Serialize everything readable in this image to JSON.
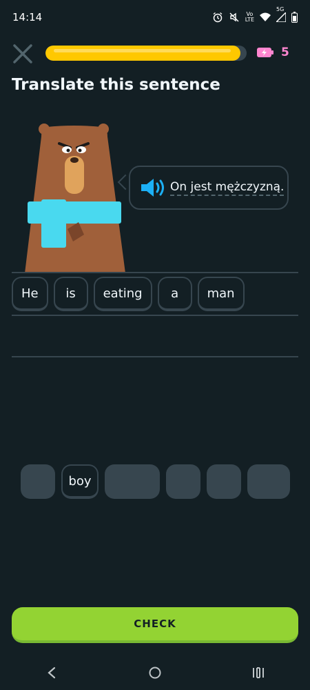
{
  "status_bar": {
    "time": "14:14",
    "icons": [
      "alarm-icon",
      "mute-icon",
      "volte-icon",
      "wifi-icon",
      "signal-5g-icon",
      "battery-icon"
    ],
    "network_label": "5G",
    "volte_label_top": "Vo",
    "volte_label_bottom": "LTE"
  },
  "lesson": {
    "progress_fraction": 0.97,
    "progress_color": "#ffc800",
    "energy_count": "5",
    "energy_color": "#ff86d0"
  },
  "title": "Translate this sentence",
  "prompt": {
    "sentence": "On jest mężczyzną."
  },
  "answer_chips": [
    "He",
    "is",
    "eating",
    "a",
    "man"
  ],
  "word_bank": [
    {
      "label": "",
      "filled": false
    },
    {
      "label": "boy",
      "filled": true
    },
    {
      "label": "",
      "filled": false
    },
    {
      "label": "",
      "filled": false
    },
    {
      "label": "",
      "filled": false
    },
    {
      "label": "",
      "filled": false
    }
  ],
  "check_button": {
    "label": "CHECK",
    "color": "#93d333"
  },
  "colors": {
    "background": "#131f24",
    "border": "#37464f",
    "accent_blue": "#1cb0f6"
  }
}
